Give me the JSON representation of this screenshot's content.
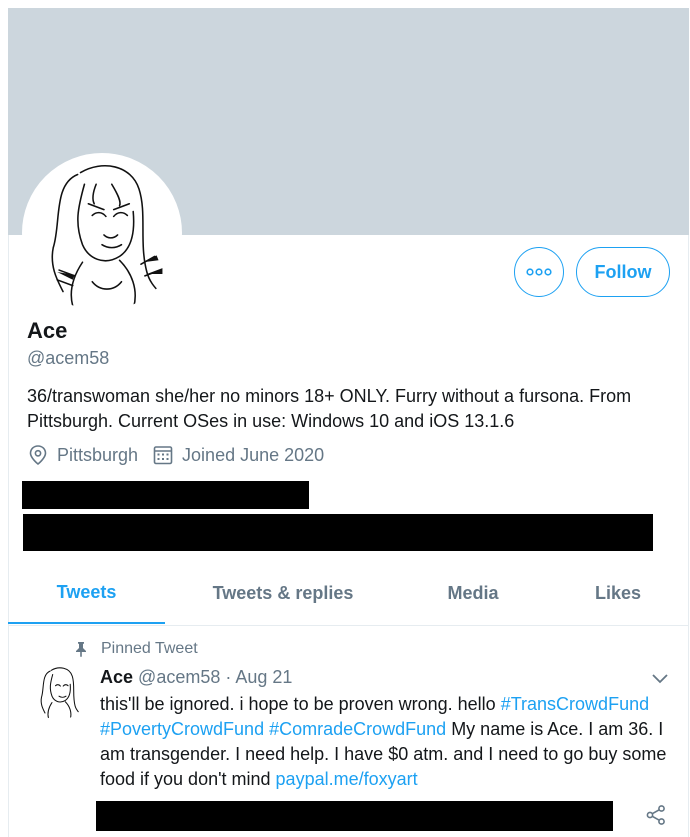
{
  "profile": {
    "name": "Ace",
    "handle": "@acem58",
    "bio": "36/transwoman she/her no minors 18+ ONLY.  Furry without a fursona. From Pittsburgh. Current OSes in use: Windows 10 and iOS 13.1.6",
    "location": "Pittsburgh",
    "joined": "Joined June 2020",
    "follow_label": "Follow",
    "more_icon": "more-icon"
  },
  "tabs": [
    {
      "label": "Tweets",
      "active": true
    },
    {
      "label": "Tweets & replies",
      "active": false
    },
    {
      "label": "Media",
      "active": false
    },
    {
      "label": "Likes",
      "active": false
    }
  ],
  "tweet": {
    "pinned_label": "Pinned Tweet",
    "name": "Ace",
    "handle": "@acem58",
    "separator": "·",
    "date": "Aug 21",
    "text_a": "this'll be ignored. i hope to be proven wrong. hello ",
    "hashtag1": "#TransCrowdFund",
    "text_b": " ",
    "hashtag2": "#PovertyCrowdFund",
    "text_c": " ",
    "hashtag3": "#ComradeCrowdFund",
    "text_d": " My name is Ace. I am 36. I am transgender. I need help. I have $0 atm. and I need to go buy some food if you don't mind ",
    "link": "paypal.me/foxyart"
  },
  "colors": {
    "accent": "#1da1f2",
    "banner": "#ccd6dd",
    "secondary_text": "#657786"
  }
}
